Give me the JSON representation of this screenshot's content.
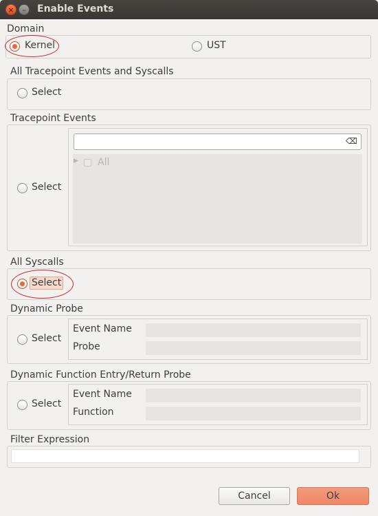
{
  "window": {
    "title": "Enable Events",
    "close_glyph": "×",
    "minimize_glyph": "–"
  },
  "domain": {
    "label": "Domain",
    "options": [
      {
        "label": "Kernel",
        "selected": true
      },
      {
        "label": "UST",
        "selected": false
      }
    ]
  },
  "all_tracepoints": {
    "label": "All Tracepoint Events and Syscalls",
    "radio_label": "Select",
    "selected": false
  },
  "tracepoint_events": {
    "label": "Tracepoint Events",
    "radio_label": "Select",
    "selected": false,
    "filter_value": "",
    "clear_icon": "⌫",
    "tree": [
      {
        "label": "All",
        "checked": false,
        "expandable": true
      }
    ]
  },
  "all_syscalls": {
    "label": "All Syscalls",
    "radio_label": "Select",
    "selected": true
  },
  "dynamic_probe": {
    "label": "Dynamic Probe",
    "radio_label": "Select",
    "selected": false,
    "fields": [
      {
        "label": "Event Name",
        "value": ""
      },
      {
        "label": "Probe",
        "value": ""
      }
    ]
  },
  "dynamic_function": {
    "label": "Dynamic Function Entry/Return Probe",
    "radio_label": "Select",
    "selected": false,
    "fields": [
      {
        "label": "Event Name",
        "value": ""
      },
      {
        "label": "Function",
        "value": ""
      }
    ]
  },
  "filter_expression": {
    "label": "Filter Expression",
    "value": ""
  },
  "buttons": {
    "cancel": "Cancel",
    "ok": "Ok"
  },
  "colors": {
    "accent": "#e8663c",
    "titlebar": "#3c3b37",
    "annotation": "#c6262e",
    "ok_button": "#f0906f"
  }
}
